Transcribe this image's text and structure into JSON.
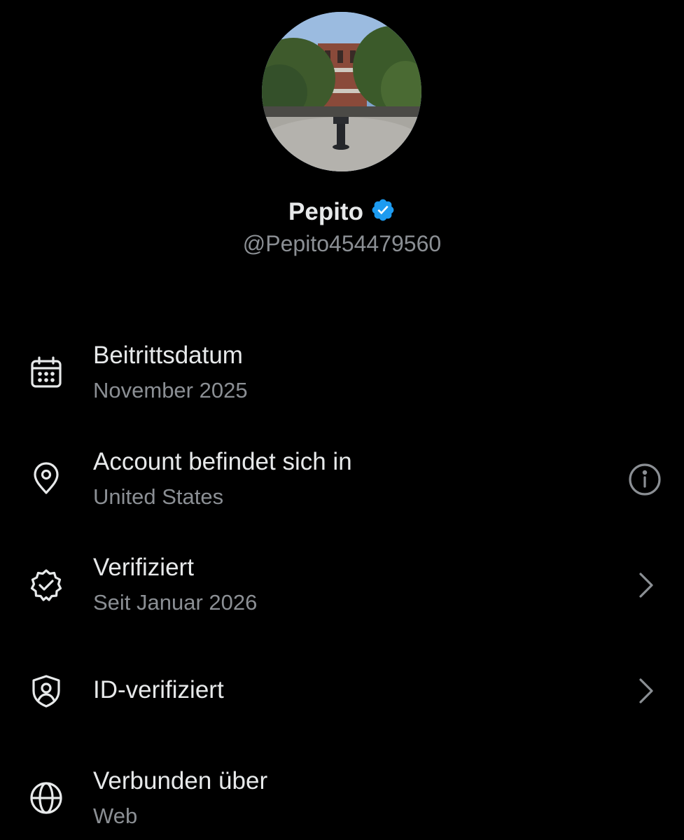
{
  "profile": {
    "display_name": "Pepito",
    "handle": "@Pepito454479560",
    "verified_badge_color": "#1d9bf0"
  },
  "rows": [
    {
      "title": "Beitrittsdatum",
      "subtitle": "November 2025",
      "icon": "calendar-icon",
      "action": null
    },
    {
      "title": "Account befindet sich in",
      "subtitle": "United States",
      "icon": "location-pin-icon",
      "action": "info-icon"
    },
    {
      "title": "Verifiziert",
      "subtitle": "Seit Januar 2026",
      "icon": "verified-check-icon",
      "action": "chevron-right-icon"
    },
    {
      "title": "ID-verifiziert",
      "subtitle": "",
      "icon": "id-shield-icon",
      "action": "chevron-right-icon"
    },
    {
      "title": "Verbunden über",
      "subtitle": "Web",
      "icon": "globe-icon",
      "action": null
    }
  ],
  "colors": {
    "background": "#000000",
    "primary_text": "#e7e9ea",
    "secondary_text": "#8b8f94"
  }
}
